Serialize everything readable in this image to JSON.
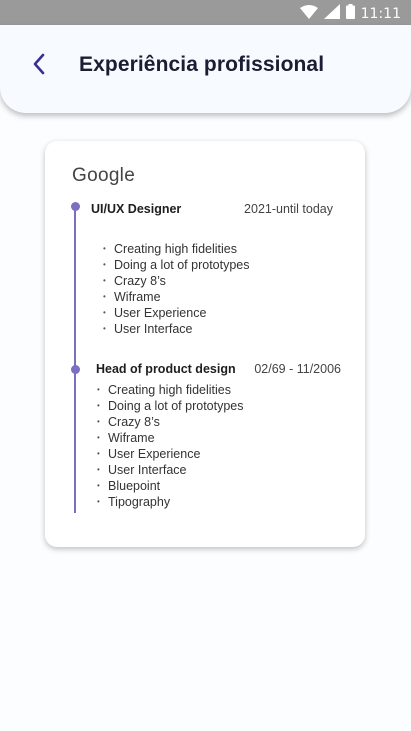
{
  "status_bar": {
    "time": "11:11",
    "icons": [
      "wifi-icon",
      "signal-icon",
      "battery-icon"
    ]
  },
  "header": {
    "back_icon": "chevron-left-icon",
    "title": "Experiência profissional"
  },
  "card": {
    "company": "Google",
    "jobs": [
      {
        "title": "UI/UX Designer",
        "period": "2021-until today",
        "tasks": [
          "Creating high fidelities",
          "Doing a lot of prototypes",
          "Crazy 8’s",
          "Wiframe",
          "User Experience",
          "User Interface"
        ]
      },
      {
        "title": "Head of product design",
        "period": "02/69 - 11/2006",
        "tasks": [
          "Creating high fidelities",
          "Doing a lot of prototypes",
          "Crazy 8’s",
          "Wiframe",
          "User Experience",
          "User Interface",
          "Bluepoint",
          "Tipography"
        ]
      }
    ]
  },
  "colors": {
    "status_bar": "#9a9a9a",
    "header_bg": "#f7fbff",
    "accent": "#7a6fc0",
    "title": "#1c1d33",
    "back_icon": "#3a2f8f"
  }
}
